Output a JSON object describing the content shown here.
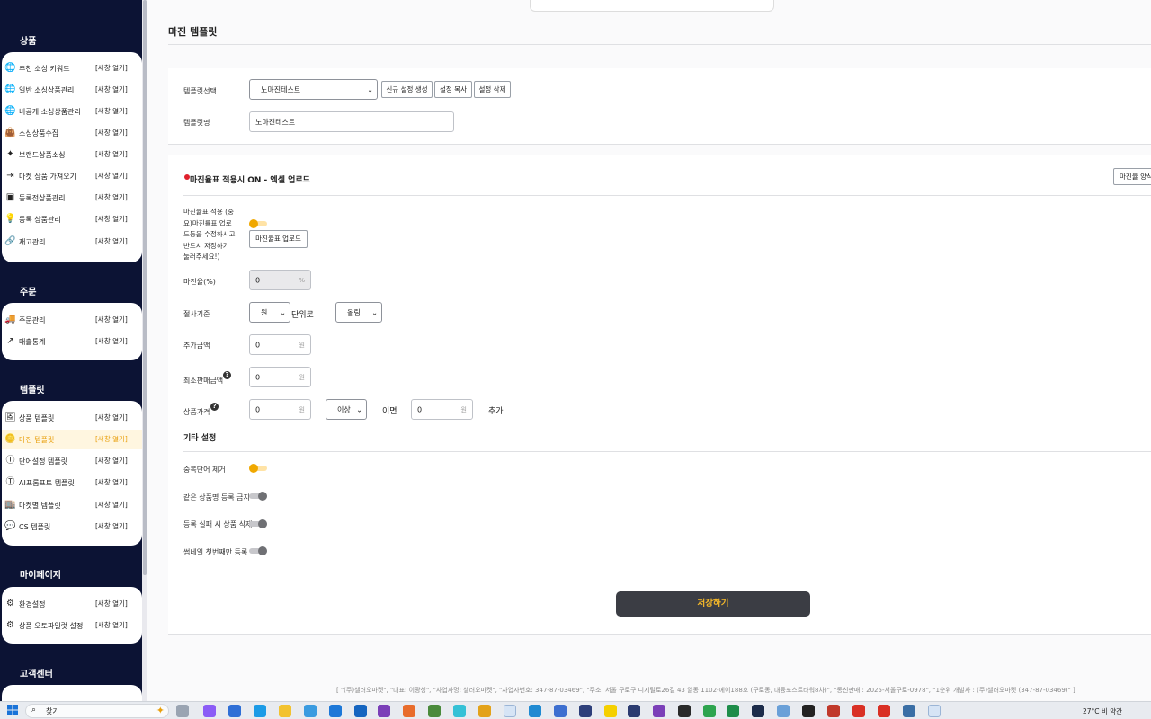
{
  "sidebar": {
    "sections": [
      {
        "title": "상품",
        "items": [
          {
            "label": "추천 소싱 키워드",
            "link": "[새창 열기]",
            "icon": "globe-icon"
          },
          {
            "label": "일반 소싱상품관리",
            "link": "[새창 열기]",
            "icon": "globe-icon"
          },
          {
            "label": "비공개 소싱상품관리",
            "link": "[새창 열기]",
            "icon": "globe-icon"
          },
          {
            "label": "소싱상품수집",
            "link": "[새창 열기]",
            "icon": "bag-icon"
          },
          {
            "label": "브랜드상품소싱",
            "link": "[새창 열기]",
            "icon": "sparkle-icon"
          },
          {
            "label": "마켓 상품 가져오기",
            "link": "[새창 열기]",
            "icon": "import-icon"
          },
          {
            "label": "등록전상품관리",
            "link": "[새창 열기]",
            "icon": "window-icon"
          },
          {
            "label": "등록 상품관리",
            "link": "[새창 열기]",
            "icon": "lightbulb-icon"
          },
          {
            "label": "재고관리",
            "link": "[새창 열기]",
            "icon": "link-icon"
          }
        ]
      },
      {
        "title": "주문",
        "items": [
          {
            "label": "주문관리",
            "link": "[새창 열기]",
            "icon": "truck-icon"
          },
          {
            "label": "매출통계",
            "link": "[새창 열기]",
            "icon": "trend-icon"
          }
        ]
      },
      {
        "title": "템플릿",
        "items": [
          {
            "label": "상품 템플릿",
            "link": "[새창 열기]",
            "icon": "image-icon"
          },
          {
            "label": "마진 템플릿",
            "link": "[새창 열기]",
            "icon": "coins-icon"
          },
          {
            "label": "단어설정 템플릿",
            "link": "[새창 열기]",
            "icon": "text-icon"
          },
          {
            "label": "AI프롬프트 템플릿",
            "link": "[새창 열기]",
            "icon": "text-icon"
          },
          {
            "label": "마켓별 템플릿",
            "link": "[새창 열기]",
            "icon": "store-icon"
          },
          {
            "label": "CS 템플릿",
            "link": "[새창 열기]",
            "icon": "chat-icon"
          }
        ]
      },
      {
        "title": "마이페이지",
        "items": [
          {
            "label": "환경설정",
            "link": "[새창 열기]",
            "icon": "gear-icon"
          },
          {
            "label": "상품 오토파일럿 설정",
            "link": "[새창 열기]",
            "icon": "gear-icon"
          }
        ]
      },
      {
        "title": "고객센터",
        "items": []
      }
    ]
  },
  "page": {
    "title": "마진 템플릿"
  },
  "template": {
    "select_label": "템플릿선택",
    "select_value": "노마진테스트",
    "buttons": [
      "신규 설정 생성",
      "설정 복사",
      "설정 삭제"
    ],
    "name_label": "템플릿명",
    "name_value": "노마진테스트"
  },
  "margin": {
    "section_title": "마진율표 적용시 ON - 엑셀 업로드",
    "sample_button": "마진율 양식",
    "apply_label": "마진율표 적용 (중요)마진률표 업로드등을 수정하시고 반드시 저장하기 눌러주세요!)",
    "upload_button": "마진율표 업로드",
    "rate_label": "마진율(%)",
    "rate_value": "0",
    "rate_unit": "%",
    "rounding_label": "절사기준",
    "rounding_unit": "원",
    "rounding_mid": "단위로",
    "rounding_mode": "올림",
    "add_amount_label": "추가금액",
    "add_amount_value": "0",
    "add_amount_unit": "원",
    "min_price_label": "최소판매금액",
    "min_price_value": "0",
    "min_price_unit": "원",
    "product_price_label": "상품가격",
    "product_price_value": "0",
    "product_price_unit": "원",
    "condition": "이상",
    "condition_text": "이면",
    "extra_value": "0",
    "extra_unit": "원",
    "extra_text": "추가"
  },
  "other": {
    "title": "기타 설정",
    "toggles": [
      {
        "label": "중복단어 제거",
        "on": true
      },
      {
        "label": "같은 상품명 등록 금지",
        "on": false
      },
      {
        "label": "등록 실패 시 상품 삭제",
        "on": false
      },
      {
        "label": "썸네일 첫번째만 등록",
        "on": false
      }
    ]
  },
  "save_label": "저장하기",
  "footer": "[ \"(주)셀러오마켓\", \"대표: 이광성\", \"사업자명: 셀러오마켓\", \"사업자번호: 347-87-03469\", \"주소: 서울 구로구 디지털로26길 43 알동 1102-에이188호 (구로동, 대륭포스트타워8차)\", \"통신판매 : 2025-서울구로-0978\", \"1순위 개발사 : (주)셀러오마켓 (347-87-03469)\" ]",
  "taskbar": {
    "search_text": "찾기",
    "weather": "27°C 비 약간"
  },
  "colors": {
    "accent": "#f0a800",
    "sidebar": "#0c1334",
    "save_button": "#3b3d44"
  }
}
